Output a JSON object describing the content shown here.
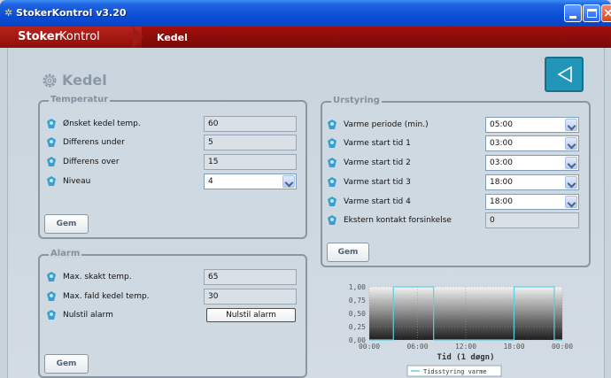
{
  "window": {
    "title": "StokerKontrol v3.20"
  },
  "appbar": {
    "brand_strong": "Stoker",
    "brand_light": "Kontrol",
    "crumb": "Kedel"
  },
  "page": {
    "title": "Kedel"
  },
  "icons": {
    "title": "app-icon",
    "settings": "gear-icon",
    "back": "back-triangle-icon",
    "info": "info-icon",
    "dropdown": "chevron-down-icon"
  },
  "colors": {
    "header_red": "#9a120f",
    "back_button": "#2196b8",
    "chart_series": "#5fd0e0"
  },
  "temperatur": {
    "legend": "Temperatur",
    "rows": [
      {
        "label": "Ønsket kedel temp.",
        "value": "60"
      },
      {
        "label": "Differens under",
        "value": "5"
      },
      {
        "label": "Differens over",
        "value": "15"
      },
      {
        "label": "Niveau",
        "value": "4"
      }
    ],
    "save_label": "Gem"
  },
  "alarm": {
    "legend": "Alarm",
    "rows": [
      {
        "label": "Max. skakt temp.",
        "value": "65"
      },
      {
        "label": "Max. fald kedel temp.",
        "value": "30"
      },
      {
        "label": "Nulstil alarm",
        "button_label": "Nulstil alarm"
      }
    ],
    "save_label": "Gem"
  },
  "urstyring": {
    "legend": "Urstyring",
    "rows": [
      {
        "label": "Varme periode (min.)",
        "value": "05:00"
      },
      {
        "label": "Varme start tid 1",
        "value": "03:00"
      },
      {
        "label": "Varme start tid 2",
        "value": "03:00"
      },
      {
        "label": "Varme start tid 3",
        "value": "18:00"
      },
      {
        "label": "Varme start tid 4",
        "value": "18:00"
      },
      {
        "label": "Ekstern kontakt forsinkelse",
        "value": "0"
      }
    ],
    "save_label": "Gem"
  },
  "chart_data": {
    "type": "line",
    "title": "",
    "xlabel": "Tid (1 døgn)",
    "ylabel": "",
    "x_ticks": [
      "00:00",
      "06:00",
      "12:00",
      "18:00",
      "00:00"
    ],
    "y_ticks": [
      "0,00",
      "0,25",
      "0,50",
      "0,75",
      "1,00"
    ],
    "ylim": [
      0,
      1
    ],
    "xlim": [
      0,
      24
    ],
    "grid": true,
    "legend_position": "bottom",
    "series": [
      {
        "name": "Tidsstyring varme",
        "x": [
          0,
          3,
          3,
          8,
          8,
          18,
          18,
          23,
          23,
          24
        ],
        "values": [
          0,
          0,
          1,
          1,
          0,
          0,
          1,
          1,
          0,
          0
        ]
      }
    ]
  }
}
